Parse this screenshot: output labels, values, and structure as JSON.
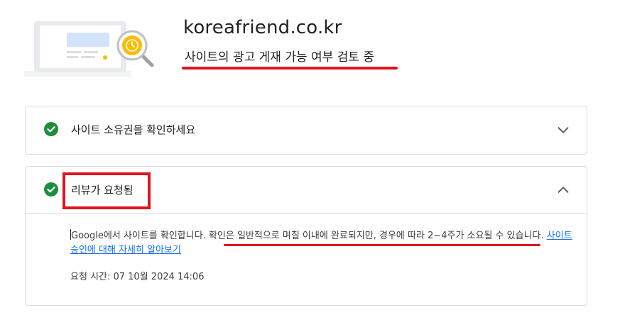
{
  "header": {
    "site_domain": "koreafriend.co.kr",
    "status_text": "사이트의 광고 게재 가능 여부 검토 중",
    "illustration_icon": "site-review-clock-magnifier-icon"
  },
  "steps": [
    {
      "title": "사이트 소유권을 확인하세요",
      "status": "complete",
      "expanded": false
    },
    {
      "title": "리뷰가 요청됨",
      "status": "complete",
      "expanded": true,
      "body": {
        "text_prefix": "Google에서 사이트를 확인합니다. 확인은 일반적으로 며칠 이내에 완료되지만, 경우에 따라 2~4주가 소요될 수 있습니다. ",
        "link_text": "사이트 승인에 대해 자세히 알아보기",
        "request_time": "요청 시간: 07 10월 2024 14:06"
      }
    }
  ],
  "colors": {
    "check_green": "#1e8e3e",
    "annotation_red": "#e0141e",
    "link_blue": "#1a73e8",
    "clock_yellow": "#fbbc04"
  }
}
